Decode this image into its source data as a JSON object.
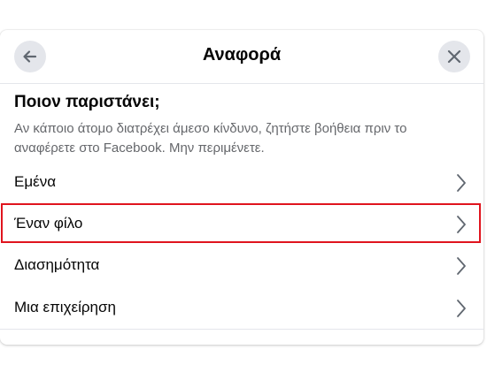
{
  "header": {
    "title": "Αναφορά",
    "back_icon": "arrow-left-icon",
    "close_icon": "close-icon"
  },
  "section": {
    "title": "Ποιον παριστάνει;",
    "description": "Αν κάποιο άτομο διατρέχει άμεσο κίνδυνο, ζητήστε βοήθεια πριν το αναφέρετε στο Facebook. Μην περιμένετε."
  },
  "options": [
    {
      "label": "Εμένα",
      "icon": "chevron-right-icon"
    },
    {
      "label": "Έναν φίλο",
      "icon": "chevron-right-icon",
      "highlighted": true
    },
    {
      "label": "Διασημότητα",
      "icon": "chevron-right-icon"
    },
    {
      "label": "Μια επιχείρηση",
      "icon": "chevron-right-icon"
    }
  ],
  "colors": {
    "highlight_border": "#e0141e",
    "secondary_text": "#65676b",
    "button_bg": "#e4e6eb"
  }
}
